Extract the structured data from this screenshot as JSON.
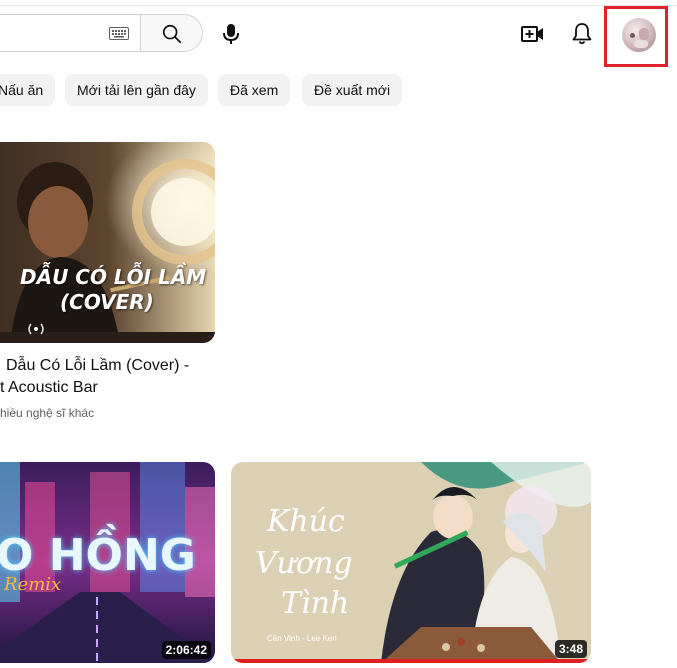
{
  "header": {
    "search_icon": "search-icon",
    "keyboard_icon": "keyboard-icon",
    "mic_icon": "microphone-icon",
    "create_icon": "create-video-icon",
    "bell_icon": "notifications-bell-icon",
    "avatar": "account-avatar",
    "highlight_color": "#e0222a"
  },
  "chips": [
    {
      "label": "Nấu ăn"
    },
    {
      "label": "Mới tải lên gần đây"
    },
    {
      "label": "Đã xem"
    },
    {
      "label": "Đề xuất mới"
    }
  ],
  "videos": [
    {
      "thumb_text_line1": "DẪU CÓ LỖI LẦM",
      "thumb_text_line2": "(COVER)",
      "live_icon": "live-broadcast-icon",
      "title_line1": "Dẫu Có Lỗi Lầm (Cover) -",
      "title_line2": "t Acoustic Bar",
      "meta": "hiều nghệ sĩ khác"
    },
    {
      "thumb_text": "O HỒNG",
      "thumb_subtext": "Remix",
      "duration": "2:06:42"
    },
    {
      "thumb_text_line1": "Khúc",
      "thumb_text_line2": "Vương",
      "thumb_text_line3": "Tình",
      "thumb_credit": "Cần Vinh - Lee Ken",
      "duration": "3:48"
    }
  ]
}
